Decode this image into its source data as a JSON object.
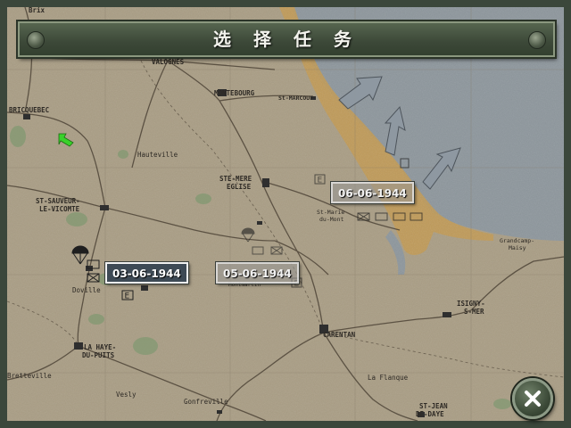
{
  "title": "选 择 任 务",
  "towns": [
    {
      "id": "brix",
      "label": "Brix"
    },
    {
      "id": "valognes",
      "label": "VALOGNES"
    },
    {
      "id": "bricquebec",
      "label": "BRICQUEBEC"
    },
    {
      "id": "montebourg",
      "label": "MONTEBOURG"
    },
    {
      "id": "st-marcouf",
      "label": "St-MARCOUF"
    },
    {
      "id": "hauteville",
      "label": "Hauteville"
    },
    {
      "id": "ste-mere-eglise-1",
      "label": "STE-MERE"
    },
    {
      "id": "ste-mere-eglise-2",
      "label": "EGLISE"
    },
    {
      "id": "st-sauveur-1",
      "label": "ST-SAUVEUR-"
    },
    {
      "id": "st-sauveur-2",
      "label": "LE-VICOMTE"
    },
    {
      "id": "st-marie-du-mont-1",
      "label": "St-Marie"
    },
    {
      "id": "st-marie-du-mont-2",
      "label": "du-Mont"
    },
    {
      "id": "grandcamp-1",
      "label": "Grandcamp-"
    },
    {
      "id": "grandcamp-2",
      "label": "Maisy"
    },
    {
      "id": "doville",
      "label": "Doville"
    },
    {
      "id": "isigny-1",
      "label": "ISIGNY-"
    },
    {
      "id": "isigny-2",
      "label": "S-MER"
    },
    {
      "id": "carentan",
      "label": "CARENTAN"
    },
    {
      "id": "la-haye-1",
      "label": "LA HAYE-"
    },
    {
      "id": "la-haye-2",
      "label": "DU-PUITS"
    },
    {
      "id": "bretteville",
      "label": "Bretteville"
    },
    {
      "id": "la-flanque",
      "label": "La Flanque"
    },
    {
      "id": "vesly",
      "label": "Vesly"
    },
    {
      "id": "gonfreville",
      "label": "Gonfreville"
    },
    {
      "id": "st-jean-1",
      "label": "ST-JEAN"
    },
    {
      "id": "st-jean-2",
      "label": "DE-DAYE"
    },
    {
      "id": "montmartin",
      "label": "Montmartin"
    }
  ],
  "missions": [
    {
      "id": "mission-03-06-1944",
      "date": "03-06-1944",
      "state": "active"
    },
    {
      "id": "mission-05-06-1944",
      "date": "05-06-1944",
      "state": "locked"
    },
    {
      "id": "mission-06-06-1944",
      "date": "06-06-1944",
      "state": "locked"
    }
  ],
  "icons": {
    "close": "close-icon",
    "parachute": "parachute-icon",
    "unit": "unit-symbol-icon",
    "engineer": "engineer-symbol-icon",
    "attack_arrow": "attack-arrow-icon",
    "cursor": "green-arrow-cursor-icon"
  },
  "colors": {
    "land": "#a99d84",
    "sea": "#8d969c",
    "coast_band": "#c49a4e",
    "frame": "#3b473b",
    "title_text": "#f4f4ee",
    "cursor": "#39d12b"
  }
}
